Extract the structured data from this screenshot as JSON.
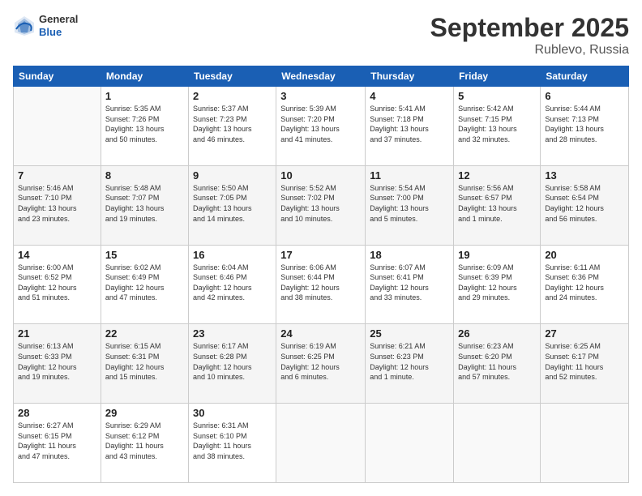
{
  "logo": {
    "general": "General",
    "blue": "Blue"
  },
  "header": {
    "month": "September 2025",
    "location": "Rublevo, Russia"
  },
  "days_of_week": [
    "Sunday",
    "Monday",
    "Tuesday",
    "Wednesday",
    "Thursday",
    "Friday",
    "Saturday"
  ],
  "weeks": [
    [
      {
        "day": "",
        "info": ""
      },
      {
        "day": "1",
        "info": "Sunrise: 5:35 AM\nSunset: 7:26 PM\nDaylight: 13 hours\nand 50 minutes."
      },
      {
        "day": "2",
        "info": "Sunrise: 5:37 AM\nSunset: 7:23 PM\nDaylight: 13 hours\nand 46 minutes."
      },
      {
        "day": "3",
        "info": "Sunrise: 5:39 AM\nSunset: 7:20 PM\nDaylight: 13 hours\nand 41 minutes."
      },
      {
        "day": "4",
        "info": "Sunrise: 5:41 AM\nSunset: 7:18 PM\nDaylight: 13 hours\nand 37 minutes."
      },
      {
        "day": "5",
        "info": "Sunrise: 5:42 AM\nSunset: 7:15 PM\nDaylight: 13 hours\nand 32 minutes."
      },
      {
        "day": "6",
        "info": "Sunrise: 5:44 AM\nSunset: 7:13 PM\nDaylight: 13 hours\nand 28 minutes."
      }
    ],
    [
      {
        "day": "7",
        "info": "Sunrise: 5:46 AM\nSunset: 7:10 PM\nDaylight: 13 hours\nand 23 minutes."
      },
      {
        "day": "8",
        "info": "Sunrise: 5:48 AM\nSunset: 7:07 PM\nDaylight: 13 hours\nand 19 minutes."
      },
      {
        "day": "9",
        "info": "Sunrise: 5:50 AM\nSunset: 7:05 PM\nDaylight: 13 hours\nand 14 minutes."
      },
      {
        "day": "10",
        "info": "Sunrise: 5:52 AM\nSunset: 7:02 PM\nDaylight: 13 hours\nand 10 minutes."
      },
      {
        "day": "11",
        "info": "Sunrise: 5:54 AM\nSunset: 7:00 PM\nDaylight: 13 hours\nand 5 minutes."
      },
      {
        "day": "12",
        "info": "Sunrise: 5:56 AM\nSunset: 6:57 PM\nDaylight: 13 hours\nand 1 minute."
      },
      {
        "day": "13",
        "info": "Sunrise: 5:58 AM\nSunset: 6:54 PM\nDaylight: 12 hours\nand 56 minutes."
      }
    ],
    [
      {
        "day": "14",
        "info": "Sunrise: 6:00 AM\nSunset: 6:52 PM\nDaylight: 12 hours\nand 51 minutes."
      },
      {
        "day": "15",
        "info": "Sunrise: 6:02 AM\nSunset: 6:49 PM\nDaylight: 12 hours\nand 47 minutes."
      },
      {
        "day": "16",
        "info": "Sunrise: 6:04 AM\nSunset: 6:46 PM\nDaylight: 12 hours\nand 42 minutes."
      },
      {
        "day": "17",
        "info": "Sunrise: 6:06 AM\nSunset: 6:44 PM\nDaylight: 12 hours\nand 38 minutes."
      },
      {
        "day": "18",
        "info": "Sunrise: 6:07 AM\nSunset: 6:41 PM\nDaylight: 12 hours\nand 33 minutes."
      },
      {
        "day": "19",
        "info": "Sunrise: 6:09 AM\nSunset: 6:39 PM\nDaylight: 12 hours\nand 29 minutes."
      },
      {
        "day": "20",
        "info": "Sunrise: 6:11 AM\nSunset: 6:36 PM\nDaylight: 12 hours\nand 24 minutes."
      }
    ],
    [
      {
        "day": "21",
        "info": "Sunrise: 6:13 AM\nSunset: 6:33 PM\nDaylight: 12 hours\nand 19 minutes."
      },
      {
        "day": "22",
        "info": "Sunrise: 6:15 AM\nSunset: 6:31 PM\nDaylight: 12 hours\nand 15 minutes."
      },
      {
        "day": "23",
        "info": "Sunrise: 6:17 AM\nSunset: 6:28 PM\nDaylight: 12 hours\nand 10 minutes."
      },
      {
        "day": "24",
        "info": "Sunrise: 6:19 AM\nSunset: 6:25 PM\nDaylight: 12 hours\nand 6 minutes."
      },
      {
        "day": "25",
        "info": "Sunrise: 6:21 AM\nSunset: 6:23 PM\nDaylight: 12 hours\nand 1 minute."
      },
      {
        "day": "26",
        "info": "Sunrise: 6:23 AM\nSunset: 6:20 PM\nDaylight: 11 hours\nand 57 minutes."
      },
      {
        "day": "27",
        "info": "Sunrise: 6:25 AM\nSunset: 6:17 PM\nDaylight: 11 hours\nand 52 minutes."
      }
    ],
    [
      {
        "day": "28",
        "info": "Sunrise: 6:27 AM\nSunset: 6:15 PM\nDaylight: 11 hours\nand 47 minutes."
      },
      {
        "day": "29",
        "info": "Sunrise: 6:29 AM\nSunset: 6:12 PM\nDaylight: 11 hours\nand 43 minutes."
      },
      {
        "day": "30",
        "info": "Sunrise: 6:31 AM\nSunset: 6:10 PM\nDaylight: 11 hours\nand 38 minutes."
      },
      {
        "day": "",
        "info": ""
      },
      {
        "day": "",
        "info": ""
      },
      {
        "day": "",
        "info": ""
      },
      {
        "day": "",
        "info": ""
      }
    ]
  ]
}
